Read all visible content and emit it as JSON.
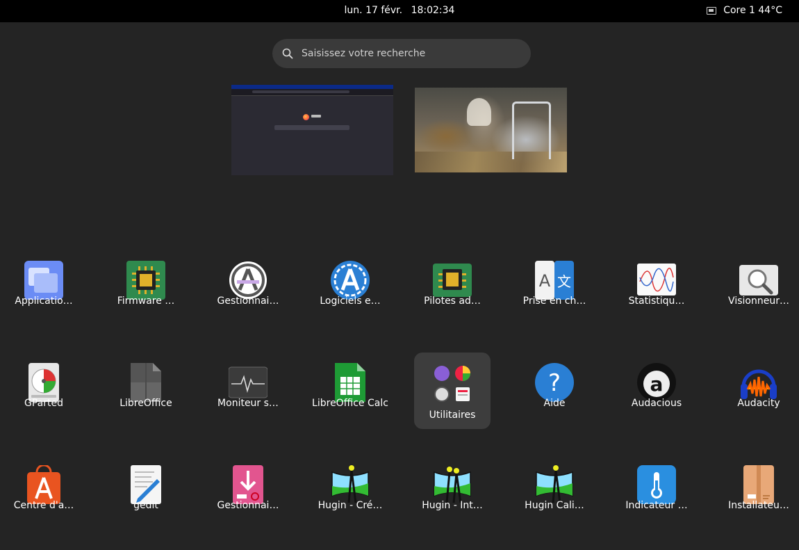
{
  "topbar": {
    "day": "lun. 17 févr.",
    "time": "18:02:34",
    "sensor_icon": "cpu-chip-icon",
    "sensor_label": "Core 1 44°C"
  },
  "search": {
    "placeholder": "Saisissez votre recherche",
    "icon": "search-icon"
  },
  "workspaces": [
    {
      "label": "firefox-window-thumbnail"
    },
    {
      "label": "image-viewer-window-thumbnail"
    }
  ],
  "apps": [
    {
      "label": "Applicatio…",
      "icon": "applications-icon"
    },
    {
      "label": "Firmware …",
      "icon": "firmware-chip-icon"
    },
    {
      "label": "Gestionnai…",
      "icon": "software-manager-icon"
    },
    {
      "label": "Logiciels e…",
      "icon": "software-updates-icon"
    },
    {
      "label": "Pilotes ad…",
      "icon": "drivers-chip-icon"
    },
    {
      "label": "Prise en ch…",
      "icon": "language-support-icon"
    },
    {
      "label": "Statistiqu…",
      "icon": "statistics-chart-icon"
    },
    {
      "label": "Visionneur…",
      "icon": "viewer-magnifier-icon"
    },
    {
      "label": "GParted",
      "icon": "gparted-disk-icon"
    },
    {
      "label": "LibreOffice",
      "icon": "libreoffice-icon"
    },
    {
      "label": "Moniteur s…",
      "icon": "system-monitor-icon"
    },
    {
      "label": "LibreOffice Calc",
      "icon": "libreoffice-calc-icon"
    },
    {
      "label": "Utilitaires",
      "icon": "utilities-folder-icon"
    },
    {
      "label": "Aide",
      "icon": "help-question-icon"
    },
    {
      "label": "Audacious",
      "icon": "audacious-icon"
    },
    {
      "label": "Audacity",
      "icon": "audacity-headphones-icon"
    },
    {
      "label": "Centre d'a…",
      "icon": "software-center-bag-icon"
    },
    {
      "label": "gedit",
      "icon": "gedit-pencil-icon"
    },
    {
      "label": "Gestionnai…",
      "icon": "package-manager-icon"
    },
    {
      "label": "Hugin - Cré…",
      "icon": "hugin-panorama-icon"
    },
    {
      "label": "Hugin - Int…",
      "icon": "hugin-batch-icon"
    },
    {
      "label": "Hugin Cali…",
      "icon": "hugin-calibrate-icon"
    },
    {
      "label": "Indicateur …",
      "icon": "thermometer-icon"
    },
    {
      "label": "Installateu…",
      "icon": "package-installer-icon"
    }
  ]
}
